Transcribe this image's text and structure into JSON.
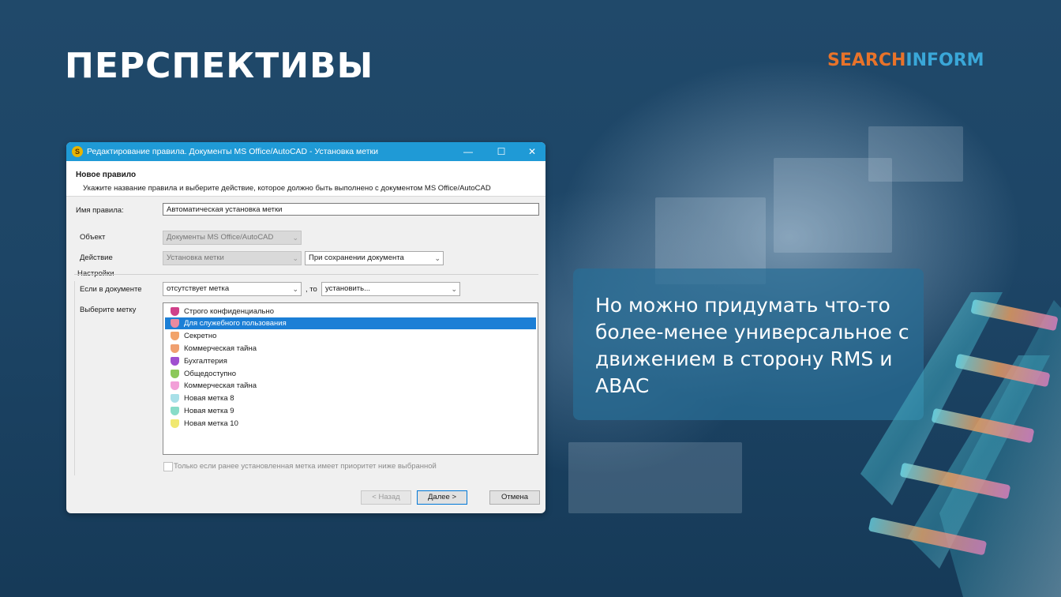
{
  "slide": {
    "title": "ПЕРСПЕКТИВЫ",
    "brand_part1": "SEARCH",
    "brand_part2": "INFORM",
    "note": "Но можно придумать что-то более-менее универсальное с движением в сторону RMS и ABAC"
  },
  "dialog": {
    "title": "Редактирование правила. Документы MS Office/AutoCAD - Установка метки",
    "controls": {
      "minimize": "—",
      "maximize": "☐",
      "close": "✕"
    },
    "header_title": "Новое правило",
    "header_subtitle": "Укажите название правила и выберите действие, которое должно быть выполнено с документом MS Office/AutoCAD",
    "rule_name_label": "Имя правила:",
    "rule_name_value": "Автоматическая установка метки",
    "object_label": "Объект",
    "object_value": "Документы MS Office/AutoCAD",
    "action_label": "Действие",
    "action_value": "Установка метки",
    "trigger_value": "При сохранении документа",
    "settings_label": "Настройки",
    "if_in_document_label": "Если в документе",
    "condition_value": "отсутствует метка",
    "then_label": ", то",
    "then_value": "установить...",
    "choose_label_label": "Выберите метку",
    "labels": [
      {
        "name": "Строго конфиденциально",
        "color": "#d0408a",
        "selected": false
      },
      {
        "name": "Для служебного пользования",
        "color": "#e98aa0",
        "selected": true
      },
      {
        "name": "Секретно",
        "color": "#f2a36a",
        "selected": false
      },
      {
        "name": "Коммерческая тайна",
        "color": "#f0a070",
        "selected": false
      },
      {
        "name": "Бухгалтерия",
        "color": "#a050d0",
        "selected": false
      },
      {
        "name": "Общедоступно",
        "color": "#8cc85a",
        "selected": false
      },
      {
        "name": "Коммерческая тайна",
        "color": "#f2a0d8",
        "selected": false
      },
      {
        "name": "Новая метка 8",
        "color": "#a8e0e8",
        "selected": false
      },
      {
        "name": "Новая метка 9",
        "color": "#88dcc8",
        "selected": false
      },
      {
        "name": "Новая метка 10",
        "color": "#f0e870",
        "selected": false
      }
    ],
    "priority_checkbox_label": "Только если ранее установленная метка имеет приоритет ниже выбранной",
    "back_button": "< Назад",
    "next_button": "Далее >",
    "cancel_button": "Отмена"
  }
}
